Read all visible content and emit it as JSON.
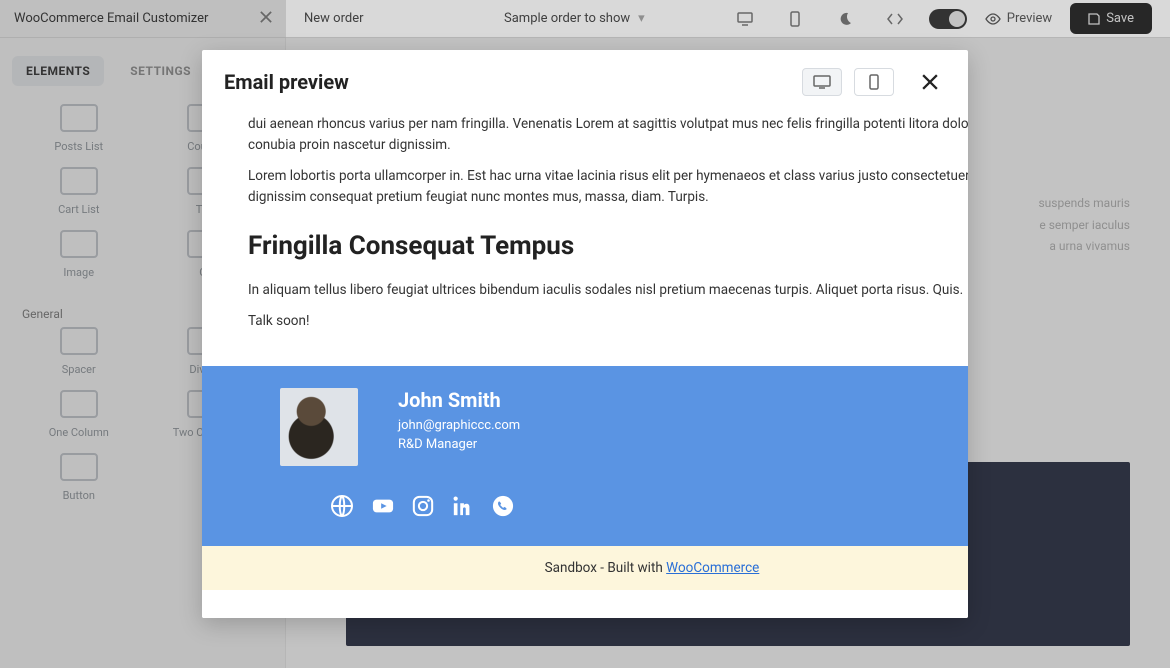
{
  "topbar": {
    "app_title": "WooCommerce Email Customizer",
    "email_type": "New order",
    "order_label": "Sample order to show",
    "preview_label": "Preview",
    "save_label": "Save"
  },
  "sidebar": {
    "tabs": {
      "elements": "ELEMENTS",
      "settings": "SETTINGS"
    },
    "section_general": "General",
    "items": [
      "Posts List",
      "Coupon",
      "Cart List",
      "Text",
      "Image",
      "Gif",
      "Spacer",
      "Divider",
      "One Column",
      "Two Columns",
      "Button"
    ]
  },
  "canvas": {
    "placeholder_lines": [
      "suspends mauris",
      "e semper iaculus",
      "",
      "a urna vivamus"
    ]
  },
  "modal": {
    "title": "Email preview"
  },
  "email": {
    "para1": "dui aenean rhoncus varius per nam fringilla. Venenatis Lorem at sagittis volutpat mus nec felis fringilla potenti litora dolor semper conubia proin nascetur dignissim.",
    "para2": "Lorem lobortis porta ullamcorper in. Est hac urna vitae lacinia risus elit per hymenaeos et class varius justo consectetuer urna vivamus dignissim consequat pretium feugiat nunc montes mus, massa, diam. Turpis.",
    "heading": "Fringilla Consequat Tempus",
    "para3": "In aliquam tellus libero feugiat ultrices bibendum iaculis sodales nisl pretium maecenas turpis. Aliquet porta risus. Quis.",
    "closing": "Talk soon!",
    "signature": {
      "name": "John Smith",
      "email": "john@graphiccc.com",
      "role": "R&D Manager"
    },
    "footer_prefix": "Sandbox - Built with ",
    "footer_link": "WooCommerce"
  }
}
